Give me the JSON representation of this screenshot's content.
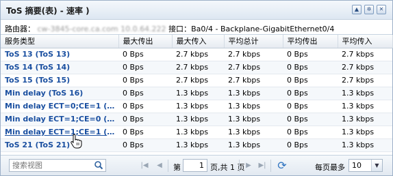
{
  "window": {
    "title": "ToS 摘要(表) - 速率 )",
    "buttons": [
      "up-arrow-icon",
      "gear-icon",
      "close-icon"
    ]
  },
  "info": {
    "router_label": "路由器：",
    "router_value": "cw-3845-core.ca.com  10.0.64.222",
    "interface_label": "接口：",
    "interface_value": "Ba0/4 - Backplane-GigabitEthernet0/4"
  },
  "table": {
    "columns": [
      "服务类型",
      "最大传出",
      "最大传入",
      "平均总计",
      "平均传出",
      "平均传入"
    ],
    "rows": [
      [
        "ToS 13 (ToS 13)",
        "0 Bps",
        "2.7 kbps",
        "2.7 kbps",
        "0 Bps",
        "2.7 kbps"
      ],
      [
        "ToS 14 (ToS 14)",
        "0 Bps",
        "2.7 kbps",
        "2.7 kbps",
        "0 Bps",
        "2.7 kbps"
      ],
      [
        "ToS 15 (ToS 15)",
        "0 Bps",
        "2.7 kbps",
        "2.7 kbps",
        "0 Bps",
        "2.7 kbps"
      ],
      [
        "Min delay (ToS 16)",
        "0 Bps",
        "1.3 kbps",
        "1.3 kbps",
        "0 Bps",
        "1.3 kbps"
      ],
      [
        "Min delay ECT=0;CE=1 (ToS...",
        "0 Bps",
        "1.3 kbps",
        "1.3 kbps",
        "0 Bps",
        "1.3 kbps"
      ],
      [
        "Min delay ECT=1;CE=0 (ToS...",
        "0 Bps",
        "1.3 kbps",
        "1.3 kbps",
        "0 Bps",
        "1.3 kbps"
      ],
      [
        "Min delay ECT=1;CE=1 (ToS...",
        "0 Bps",
        "1.3 kbps",
        "1.3 kbps",
        "0 Bps",
        "1.3 kbps"
      ],
      [
        "ToS 21 (ToS 21)",
        "0 Bps",
        "1.3 kbps",
        "1.3 kbps",
        "0 Bps",
        "1.3 kbps"
      ]
    ]
  },
  "footer": {
    "search_placeholder": "搜索视图",
    "page_prefix": "第",
    "page_current": "1",
    "page_suffix": "页,共 1 页",
    "per_page_label": "每页最多",
    "per_page_value": "10"
  },
  "colors": {
    "link": "#1a4fa0",
    "header_bg": "#e6ebf1",
    "border": "#9db0c8"
  }
}
